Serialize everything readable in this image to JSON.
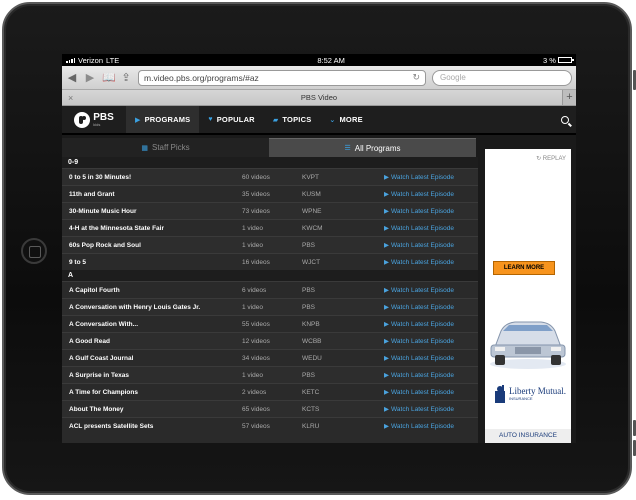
{
  "status_bar": {
    "carrier": "Verizon",
    "network": "LTE",
    "time": "8:52 AM",
    "battery": "3 %"
  },
  "browser": {
    "url": "m.video.pbs.org/programs/#az",
    "search_placeholder": "Google",
    "tab_title": "PBS Video"
  },
  "pbs_nav": {
    "logo": "PBS",
    "logo_sub": "kids",
    "items": [
      {
        "label": "PROGRAMS",
        "icon": "play-icon"
      },
      {
        "label": "POPULAR",
        "icon": "heart-icon"
      },
      {
        "label": "TOPICS",
        "icon": "folder-icon"
      },
      {
        "label": "MORE",
        "icon": "chevron-down-icon"
      }
    ]
  },
  "tabs": {
    "staff_picks": "Staff Picks",
    "all_programs": "All Programs"
  },
  "watch_label": "Watch Latest Episode",
  "sections": [
    {
      "heading": "0-9",
      "rows": [
        {
          "title": "0 to 5 in 30 Minutes!",
          "count": "60 videos",
          "station": "KVPT"
        },
        {
          "title": "11th and Grant",
          "count": "35 videos",
          "station": "KUSM"
        },
        {
          "title": "30-Minute Music Hour",
          "count": "73 videos",
          "station": "WPNE"
        },
        {
          "title": "4-H at the Minnesota State Fair",
          "count": "1 video",
          "station": "KWCM"
        },
        {
          "title": "60s Pop Rock and Soul",
          "count": "1 video",
          "station": "PBS"
        },
        {
          "title": "9 to 5",
          "count": "16 videos",
          "station": "WJCT"
        }
      ]
    },
    {
      "heading": "A",
      "rows": [
        {
          "title": "A Capitol Fourth",
          "count": "6 videos",
          "station": "PBS"
        },
        {
          "title": "A Conversation with Henry Louis Gates Jr.",
          "count": "1 video",
          "station": "PBS"
        },
        {
          "title": "A Conversation With...",
          "count": "55 videos",
          "station": "KNPB"
        },
        {
          "title": "A Good Read",
          "count": "12 videos",
          "station": "WCBB"
        },
        {
          "title": "A Gulf Coast Journal",
          "count": "34 videos",
          "station": "WEDU"
        },
        {
          "title": "A Surprise in Texas",
          "count": "1 video",
          "station": "PBS"
        },
        {
          "title": "A Time for Champions",
          "count": "2 videos",
          "station": "KETC"
        },
        {
          "title": "About The Money",
          "count": "65 videos",
          "station": "KCTS"
        },
        {
          "title": "ACL presents Satellite Sets",
          "count": "57 videos",
          "station": "KLRU"
        }
      ]
    }
  ],
  "ad": {
    "replay": "REPLAY",
    "cta": "LEARN MORE",
    "brand": "Liberty Mutual.",
    "brand_sub": "INSURANCE",
    "footer": "AUTO INSURANCE"
  }
}
